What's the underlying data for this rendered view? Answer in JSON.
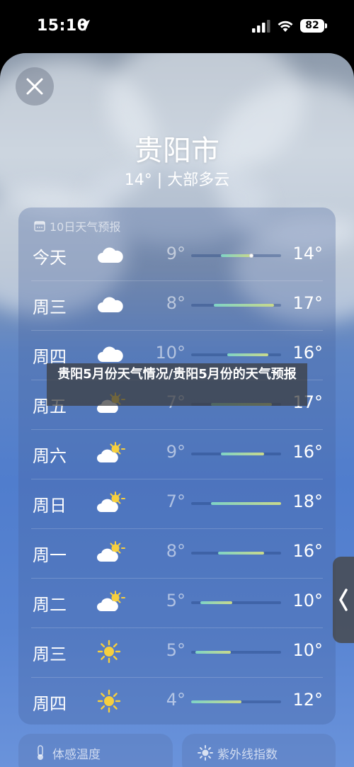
{
  "status_bar": {
    "time": "15:10",
    "battery": "82"
  },
  "header": {
    "city": "贵阳市",
    "summary": "14° | 大部多云"
  },
  "forecast": {
    "title": "10日天气预报",
    "days": [
      {
        "day": "今天",
        "icon": "cloud",
        "low": "9°",
        "high": "14°",
        "range_start": 0.33,
        "range_end": 0.67,
        "current": 0.67
      },
      {
        "day": "周三",
        "icon": "cloud",
        "low": "8°",
        "high": "17°",
        "range_start": 0.25,
        "range_end": 0.92
      },
      {
        "day": "周四",
        "icon": "cloud",
        "low": "10°",
        "high": "16°",
        "range_start": 0.4,
        "range_end": 0.86
      },
      {
        "day": "周五",
        "icon": "partly-sunny",
        "low": "7°",
        "high": "17°",
        "range_start": 0.22,
        "range_end": 0.9
      },
      {
        "day": "周六",
        "icon": "partly-sunny",
        "low": "9°",
        "high": "16°",
        "range_start": 0.33,
        "range_end": 0.81
      },
      {
        "day": "周日",
        "icon": "partly-sunny",
        "low": "7°",
        "high": "18°",
        "range_start": 0.22,
        "range_end": 1.0
      },
      {
        "day": "周一",
        "icon": "partly-sunny",
        "low": "8°",
        "high": "16°",
        "range_start": 0.3,
        "range_end": 0.81
      },
      {
        "day": "周二",
        "icon": "partly-sunny",
        "low": "5°",
        "high": "10°",
        "range_start": 0.1,
        "range_end": 0.46
      },
      {
        "day": "周三",
        "icon": "sun",
        "low": "5°",
        "high": "10°",
        "range_start": 0.05,
        "range_end": 0.44
      },
      {
        "day": "周四",
        "icon": "sun",
        "low": "4°",
        "high": "12°",
        "range_start": 0.0,
        "range_end": 0.56
      }
    ]
  },
  "bottom_cards": {
    "feels_like": "体感温度",
    "uv_index": "紫外线指数"
  },
  "overlay_caption": "贵阳5月份天气情况/贵阳5月份的天气预报"
}
